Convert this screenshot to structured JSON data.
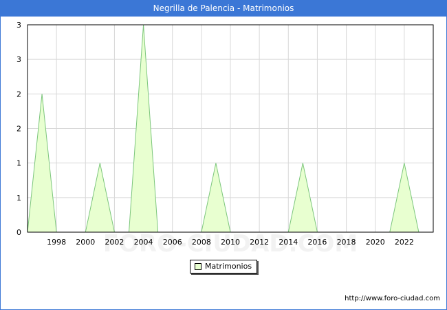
{
  "header": {
    "title": "Negrilla de Palencia - Matrimonios"
  },
  "footer": {
    "url": "http://www.foro-ciudad.com"
  },
  "watermark": "FORO-CIUDAD.COM",
  "colors": {
    "title_bar": "#3b77d6",
    "area_fill": "#e8ffd0",
    "area_stroke": "#7cc67c",
    "grid": "#d8d8d8"
  },
  "chart_data": {
    "type": "area",
    "x": [
      1996,
      1997,
      1998,
      1999,
      2000,
      2001,
      2002,
      2003,
      2004,
      2005,
      2006,
      2007,
      2008,
      2009,
      2010,
      2011,
      2012,
      2013,
      2014,
      2015,
      2016,
      2017,
      2018,
      2019,
      2020,
      2021,
      2022,
      2023
    ],
    "series": [
      {
        "name": "Matrimonios",
        "values": [
          0,
          2,
          0,
          0,
          0,
          1,
          0,
          0,
          3,
          0,
          0,
          0,
          0,
          1,
          0,
          0,
          0,
          0,
          0,
          1,
          0,
          0,
          0,
          0,
          0,
          0,
          1,
          0
        ]
      }
    ],
    "x_ticks": [
      1998,
      2000,
      2002,
      2004,
      2006,
      2008,
      2010,
      2012,
      2014,
      2016,
      2018,
      2020,
      2022
    ],
    "y_ticks": [
      {
        "value": 0,
        "label": "0"
      },
      {
        "value": 0.5,
        "label": "1"
      },
      {
        "value": 1,
        "label": "1"
      },
      {
        "value": 1.5,
        "label": "2"
      },
      {
        "value": 2,
        "label": "2"
      },
      {
        "value": 2.5,
        "label": "3"
      },
      {
        "value": 3,
        "label": "3"
      }
    ],
    "xlim": [
      1996,
      2024
    ],
    "ylim": [
      0,
      3
    ],
    "grid": true,
    "legend": "bottom-center"
  }
}
